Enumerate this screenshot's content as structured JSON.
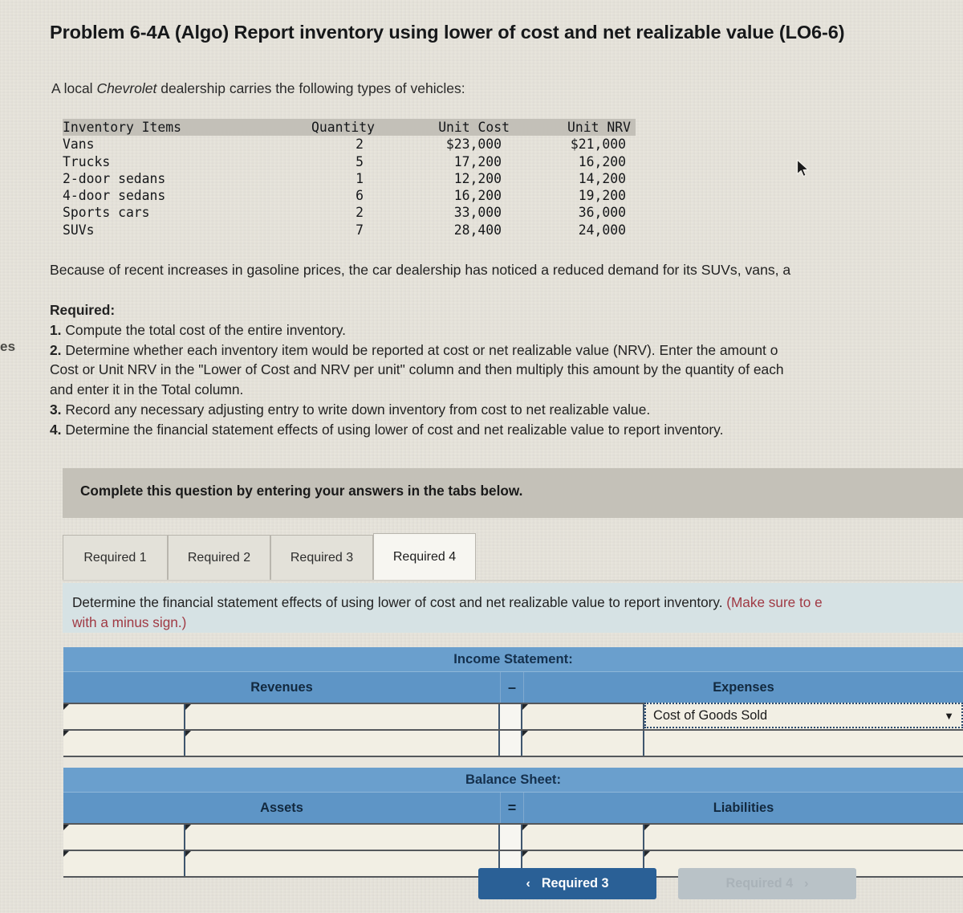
{
  "problem": {
    "title": "Problem 6-4A (Algo) Report inventory using lower of cost and net realizable value (LO6-6)",
    "intro_before": "A local ",
    "intro_italic": "Chevrolet",
    "intro_after": " dealership carries the following types of vehicles:"
  },
  "inventory_table": {
    "headers": [
      "Inventory Items",
      "Quantity",
      "Unit Cost",
      "Unit NRV"
    ],
    "rows": [
      {
        "item": "Vans",
        "quantity": "2",
        "unit_cost": "$23,000",
        "unit_nrv": "$21,000"
      },
      {
        "item": "Trucks",
        "quantity": "5",
        "unit_cost": "17,200",
        "unit_nrv": "16,200"
      },
      {
        "item": "2-door sedans",
        "quantity": "1",
        "unit_cost": "12,200",
        "unit_nrv": "14,200"
      },
      {
        "item": "4-door sedans",
        "quantity": "6",
        "unit_cost": "16,200",
        "unit_nrv": "19,200"
      },
      {
        "item": "Sports cars",
        "quantity": "2",
        "unit_cost": "33,000",
        "unit_nrv": "36,000"
      },
      {
        "item": "SUVs",
        "quantity": "7",
        "unit_cost": "28,400",
        "unit_nrv": "24,000"
      }
    ]
  },
  "body": {
    "paragraph": "Because of recent increases in gasoline prices, the car dealership has noticed a reduced demand for its SUVs, vans, a",
    "required_heading": "Required:",
    "requirements": [
      {
        "num": "1.",
        "lines": [
          "Compute the total cost of the entire inventory."
        ]
      },
      {
        "num": "2.",
        "lines": [
          "Determine whether each inventory item would be reported at cost or net realizable value (NRV). Enter the amount o",
          "Cost or Unit NRV in the \"Lower of Cost and NRV per unit\" column and then multiply this amount by the quantity of each",
          "and enter it in the Total column."
        ]
      },
      {
        "num": "3.",
        "lines": [
          "Record any necessary adjusting entry to write down inventory from cost to net realizable value."
        ]
      },
      {
        "num": "4.",
        "lines": [
          "Determine the financial statement effects of using lower of cost and net realizable value to report inventory."
        ]
      }
    ]
  },
  "gutter": {
    "partial_text": "es"
  },
  "complete_band": {
    "text": "Complete this question by entering your answers in the tabs below."
  },
  "tabs": [
    {
      "label": "Required 1",
      "active": false
    },
    {
      "label": "Required 2",
      "active": false
    },
    {
      "label": "Required 3",
      "active": false
    },
    {
      "label": "Required 4",
      "active": true
    }
  ],
  "instruction": {
    "black_text": "Determine the financial statement effects of using lower of cost and net realizable value to report inventory. ",
    "red_text_line1": "(Make sure to e",
    "red_text_line2": "with a minus sign.)"
  },
  "worksheet": {
    "income_statement": {
      "title": "Income Statement:",
      "left_header": "Revenues",
      "operator": "–",
      "right_header": "Expenses",
      "rows": [
        {
          "left_narrow": "",
          "left_wide": "",
          "right_narrow": "",
          "right_wide": "Cost of Goods Sold",
          "right_is_dropdown": true
        },
        {
          "left_narrow": "",
          "left_wide": "",
          "right_narrow": "",
          "right_wide": "",
          "right_is_dropdown": false
        }
      ]
    },
    "balance_sheet": {
      "title": "Balance Sheet:",
      "left_header": "Assets",
      "operator": "=",
      "right_header": "Liabilities",
      "rows": [
        {
          "left_narrow": "",
          "left_wide": "",
          "right_narrow": "",
          "right_wide": ""
        },
        {
          "left_narrow": "",
          "left_wide": "",
          "right_narrow": "",
          "right_wide": ""
        }
      ]
    }
  },
  "nav": {
    "prev_chevron": "‹",
    "prev_label": "Required 3",
    "next_label": "Required 4",
    "next_chevron": "›"
  },
  "colors": {
    "page_bg": "#e9e6dd",
    "band_grey": "#c4c1b8",
    "instruction_bg": "#d6e2e4",
    "table_blue_header": "#5e95c6",
    "table_blue_title": "#6a9fcd",
    "cell_bg": "#f2efe4",
    "accent_blue_button": "#2a6096",
    "disabled_button": "#b9c2c7",
    "red_text": "#a03a44"
  },
  "icons": {
    "dropdown_arrow": "▼",
    "mouse_cursor": "cursor-arrow"
  }
}
